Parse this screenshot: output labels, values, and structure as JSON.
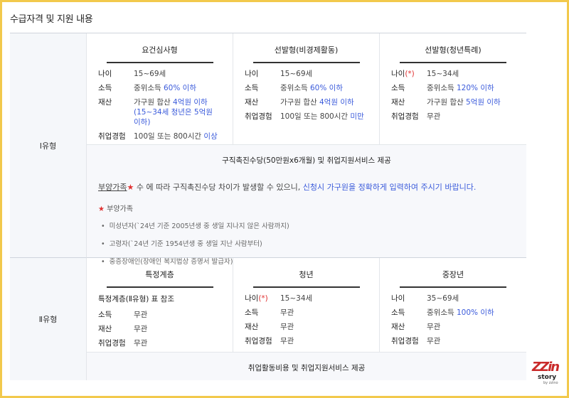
{
  "title": "수급자격 및 지원 내용",
  "type1": {
    "label": "Ⅰ유형",
    "cols": [
      {
        "header": "요건심사형",
        "rows": [
          {
            "k": "나이",
            "v": "15~69세"
          },
          {
            "k": "소득",
            "v_pre": "중위소득 ",
            "v_hi": "60% 이하"
          },
          {
            "k": "재산",
            "v_pre": "가구원 합산 ",
            "v_hi": "4억원 이하",
            "v_extra": "(15~34세 청년은 5억원 이하)"
          },
          {
            "k": "취업경험",
            "v_pre": "100일 또는 800시간 ",
            "v_hi": "이상"
          }
        ]
      },
      {
        "header": "선발형(비경제활동)",
        "rows": [
          {
            "k": "나이",
            "v": "15~69세"
          },
          {
            "k": "소득",
            "v_pre": "중위소득 ",
            "v_hi": "60% 이하"
          },
          {
            "k": "재산",
            "v_pre": "가구원 합산 ",
            "v_hi": "4억원 이하"
          },
          {
            "k": "취업경험",
            "v_pre": "100일 또는 800시간 ",
            "v_hi": "미만"
          }
        ]
      },
      {
        "header": "선발형(청년특례)",
        "rows": [
          {
            "k": "나이",
            "k_mark": "(*)",
            "v": "15~34세"
          },
          {
            "k": "소득",
            "v_pre": "중위소득 ",
            "v_hi": "120% 이하"
          },
          {
            "k": "재산",
            "v_pre": "가구원 합산 ",
            "v_hi": "5억원 이하"
          },
          {
            "k": "취업경험",
            "v": "무관"
          }
        ]
      }
    ],
    "benefit": "구직촉진수당(50만원x6개월) 및 취업지원서비스 제공",
    "notice_dep": "부양가족",
    "notice_star": "★",
    "notice_mid": " 수 에 따라 구직촉진수당 차이가 발생할 수 있으니, ",
    "notice_hi": "신청시 가구원을 정확하게 입력하여 주시기 바랍니다.",
    "star_title": "부양가족",
    "bullets": [
      "미성년자(`24년 기준 2005년생 중 생일 지나지 않은 사람까지)",
      "고령자(`24년 기준 1954년생 중 생일 지난 사람부터)",
      "중증장애인(장애인 복지법상 증명서 발급자)"
    ]
  },
  "type2": {
    "label": "Ⅱ유형",
    "cols": [
      {
        "header": "특정계층",
        "sub": "특정계층(Ⅱ유형) 표 참조",
        "rows": [
          {
            "k": "소득",
            "v": "무관"
          },
          {
            "k": "재산",
            "v": "무관"
          },
          {
            "k": "취업경험",
            "v": "무관"
          }
        ]
      },
      {
        "header": "청년",
        "rows": [
          {
            "k": "나이",
            "k_mark": "(*)",
            "v": "15~34세"
          },
          {
            "k": "소득",
            "v": "무관"
          },
          {
            "k": "재산",
            "v": "무관"
          },
          {
            "k": "취업경험",
            "v": "무관"
          }
        ]
      },
      {
        "header": "중장년",
        "rows": [
          {
            "k": "나이",
            "v": "35~69세"
          },
          {
            "k": "소득",
            "v_pre": "중위소득 ",
            "v_hi": "100% 이하"
          },
          {
            "k": "재산",
            "v": "무관"
          },
          {
            "k": "취업경험",
            "v": "무관"
          }
        ]
      }
    ],
    "benefit": "취업활동비용 및 취업지원서비스 제공"
  },
  "logo": {
    "brand": "ZZin",
    "sub": "story",
    "by": "by zzino"
  }
}
